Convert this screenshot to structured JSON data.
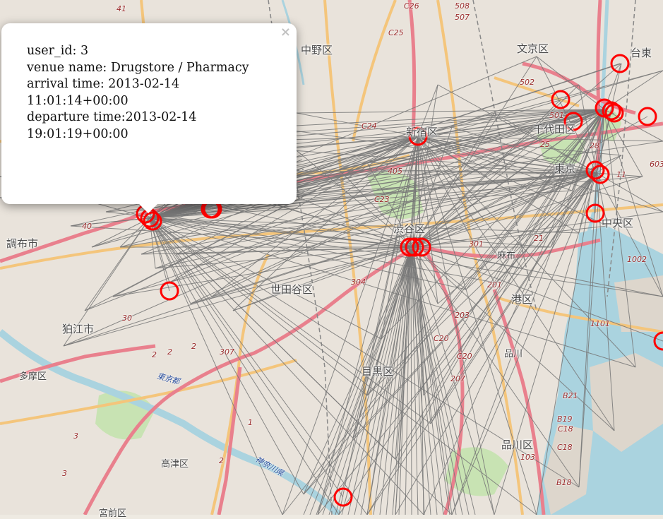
{
  "map": {
    "wards": [
      "中野区",
      "文京区",
      "台東",
      "新宿区",
      "千代田区",
      "東京",
      "中央区",
      "渋谷区",
      "世田谷区",
      "港区",
      "目黒区",
      "品川区",
      "品川",
      "麻布",
      "品川区",
      "高津区",
      "宮前区"
    ],
    "cities": [
      "調布市",
      "狛江市",
      "多摩区"
    ],
    "routes": [
      "41",
      "C26",
      "508",
      "507",
      "C25",
      "502",
      "501",
      "25",
      "C24",
      "405",
      "C23",
      "40",
      "28",
      "603",
      "21",
      "301",
      "304",
      "201",
      "203",
      "30",
      "1002",
      "1101",
      "C20",
      "C20",
      "207",
      "2",
      "2",
      "307",
      "B21",
      "B19",
      "C18",
      "C18",
      "103",
      "B18",
      "2",
      "3",
      "3",
      "1",
      "2",
      "11"
    ],
    "rivers": [
      "東京都",
      "神奈川県"
    ],
    "colors": {
      "marker": "#ff0000",
      "link": "#777777",
      "water": "#aad3df",
      "park": "#c8e3b3",
      "primary_road": "#e9808d",
      "secondary_road": "#f4c57b"
    },
    "marker_count": 22
  },
  "popup": {
    "close": "×",
    "lines": [
      "user_id: 3",
      "venue name: Drugstore / Pharmacy",
      "arrival time: 2013-02-14 11:01:14+00:00",
      "departure time:2013-02-14 19:01:19+00:00"
    ]
  }
}
